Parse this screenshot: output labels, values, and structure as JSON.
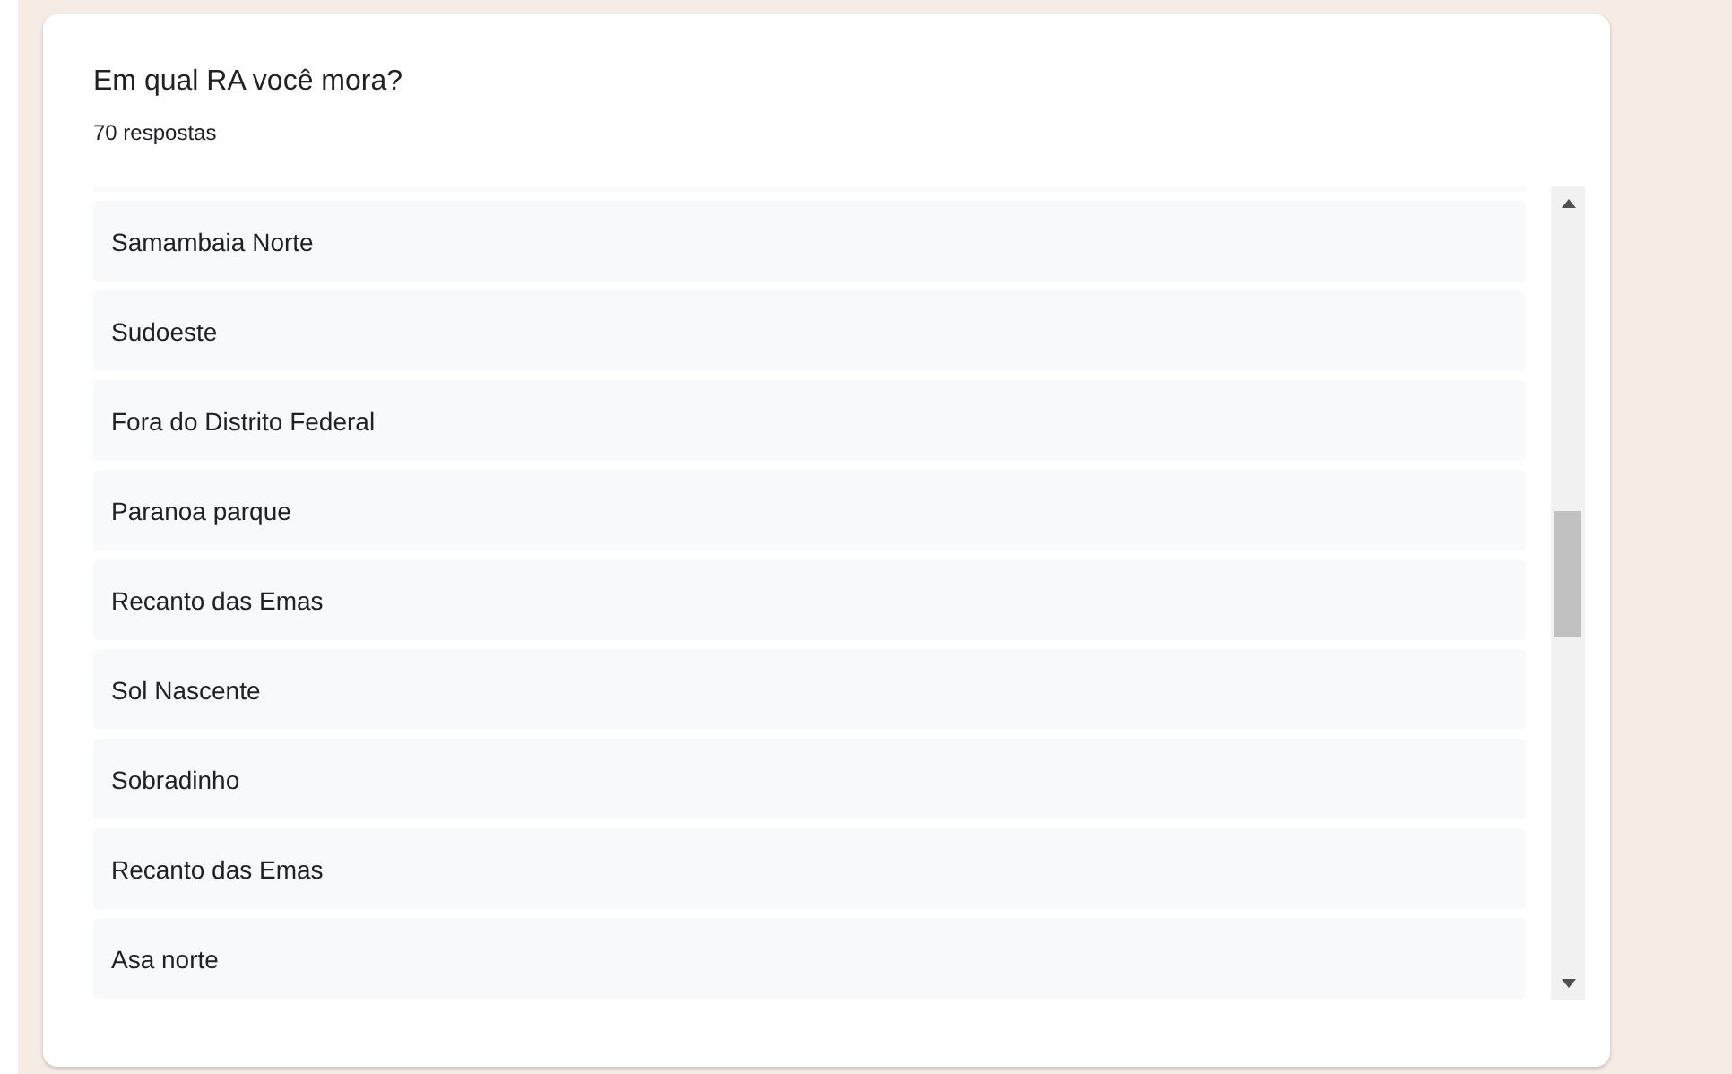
{
  "question": {
    "title": "Em qual RA você mora?",
    "count": "70 respostas"
  },
  "responses": [
    "Samambaia Norte",
    "Sudoeste",
    "Fora do Distrito Federal",
    "Paranoa parque",
    "Recanto das Emas",
    "Sol Nascente",
    "Sobradinho",
    "Recanto das Emas",
    "Asa norte"
  ]
}
